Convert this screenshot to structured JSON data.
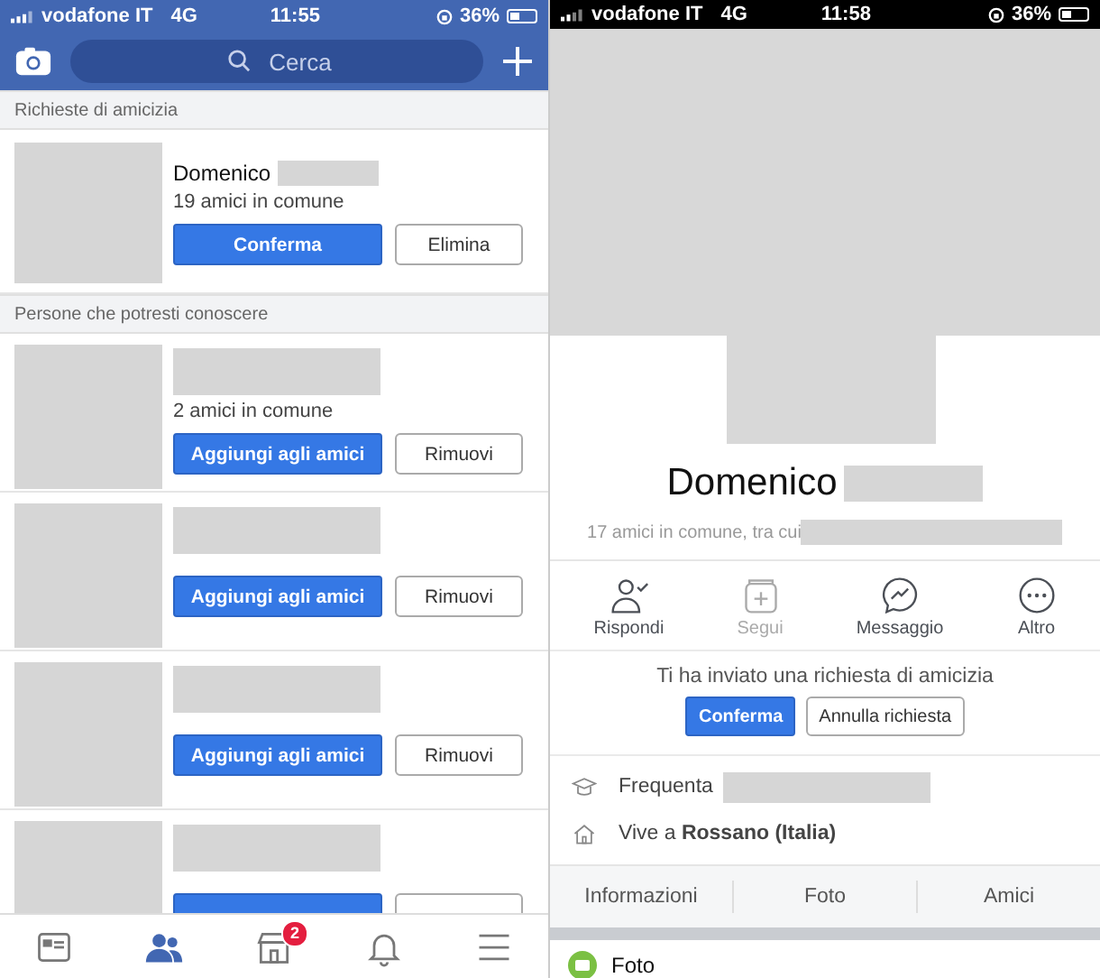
{
  "left": {
    "status_bar": {
      "carrier": "vodafone IT",
      "network": "4G",
      "time": "11:55",
      "battery": "36%"
    },
    "search": {
      "placeholder": "Cerca"
    },
    "requests": {
      "heading": "Richieste di amicizia",
      "items": [
        {
          "name": "Domenico",
          "mutual": "19 amici in comune",
          "confirm": "Conferma",
          "delete": "Elimina"
        }
      ]
    },
    "suggestions": {
      "heading": "Persone che potresti conoscere",
      "items": [
        {
          "kind": "full",
          "mutual": "2 amici in comune",
          "add": "Aggiungi agli amici",
          "remove": "Rimuovi"
        },
        {
          "kind": "full",
          "add": "Aggiungi agli amici",
          "remove": "Rimuovi"
        },
        {
          "kind": "full",
          "add": "Aggiungi agli amici",
          "remove": "Rimuovi"
        },
        {
          "kind": "cut"
        }
      ]
    },
    "tab_bar": [
      {
        "kind": "feed",
        "selected": false
      },
      {
        "kind": "friends",
        "selected": true
      },
      {
        "kind": "market",
        "selected": false,
        "badge": "2"
      },
      {
        "kind": "bell",
        "selected": false
      },
      {
        "kind": "menu",
        "selected": false
      }
    ]
  },
  "right": {
    "status_bar": {
      "carrier": "vodafone IT",
      "network": "4G",
      "time": "11:58",
      "battery": "36%"
    },
    "name": "Domenico",
    "mutual": "17 amici in comune, tra cui",
    "actions": [
      {
        "kind": "respond",
        "label": "Rispondi",
        "disabled": false
      },
      {
        "kind": "follow",
        "label": "Segui",
        "disabled": true
      },
      {
        "kind": "message",
        "label": "Messaggio",
        "disabled": false
      },
      {
        "kind": "more",
        "label": "Altro",
        "disabled": false
      }
    ],
    "request": {
      "text": "Ti ha inviato una richiesta di amicizia",
      "confirm": "Conferma",
      "cancel": "Annulla richiesta"
    },
    "details": [
      {
        "kind": "school",
        "text": "Frequenta"
      },
      {
        "kind": "home",
        "text": "Vive a **Rossano (Italia)**"
      }
    ],
    "tabs": [
      {
        "label": "Informazioni"
      },
      {
        "label": "Foto"
      },
      {
        "label": "Amici"
      }
    ],
    "section": {
      "title": "Foto"
    }
  }
}
